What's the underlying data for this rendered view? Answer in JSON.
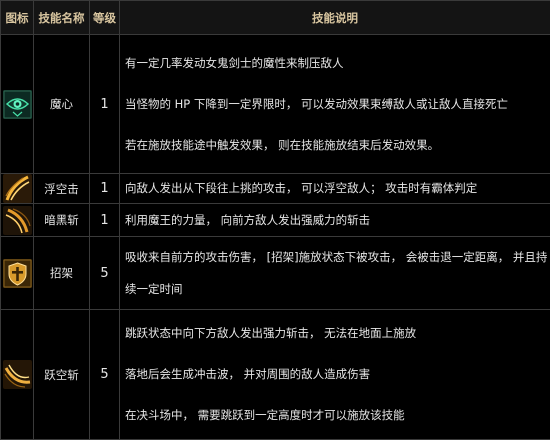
{
  "headers": {
    "icon": "图标",
    "name": "技能名称",
    "level": "等级",
    "desc": "技能说明"
  },
  "skills": [
    {
      "icon": "green-eye-heart-icon",
      "name": "魔心",
      "level": "1",
      "desc": [
        "有一定几率发动女鬼剑士的魔性来制压敌人",
        "当怪物的 HP 下降到一定界限时，  可以发动效果束缚敌人或让敌人直接死亡",
        "若在施放技能途中触发效果，  则在技能施放结束后发动效果。"
      ]
    },
    {
      "icon": "upward-slash-icon",
      "name": "浮空击",
      "level": "1",
      "desc": [
        "向敌人发出从下段往上挑的攻击，  可以浮空敌人；  攻击时有霸体判定"
      ]
    },
    {
      "icon": "dark-slash-icon",
      "name": "暗黑斩",
      "level": "1",
      "desc": [
        "利用魔王的力量，  向前方敌人发出强威力的斩击"
      ]
    },
    {
      "icon": "sword-guard-icon",
      "name": "招架",
      "level": "5",
      "desc": [
        "吸收来自前方的攻击伤害，  [招架]施放状态下被攻击，  会被击退一定距离，  并且持续一定时间"
      ]
    },
    {
      "icon": "jump-slash-icon",
      "name": "跃空斩",
      "level": "5",
      "desc": [
        "跳跃状态中向下方敌人发出强力斩击，  无法在地面上施放",
        "落地后会生成冲击波，  并对周围的敌人造成伤害",
        "在决斗场中，  需要跳跃到一定高度时才可以施放该技能"
      ]
    }
  ]
}
